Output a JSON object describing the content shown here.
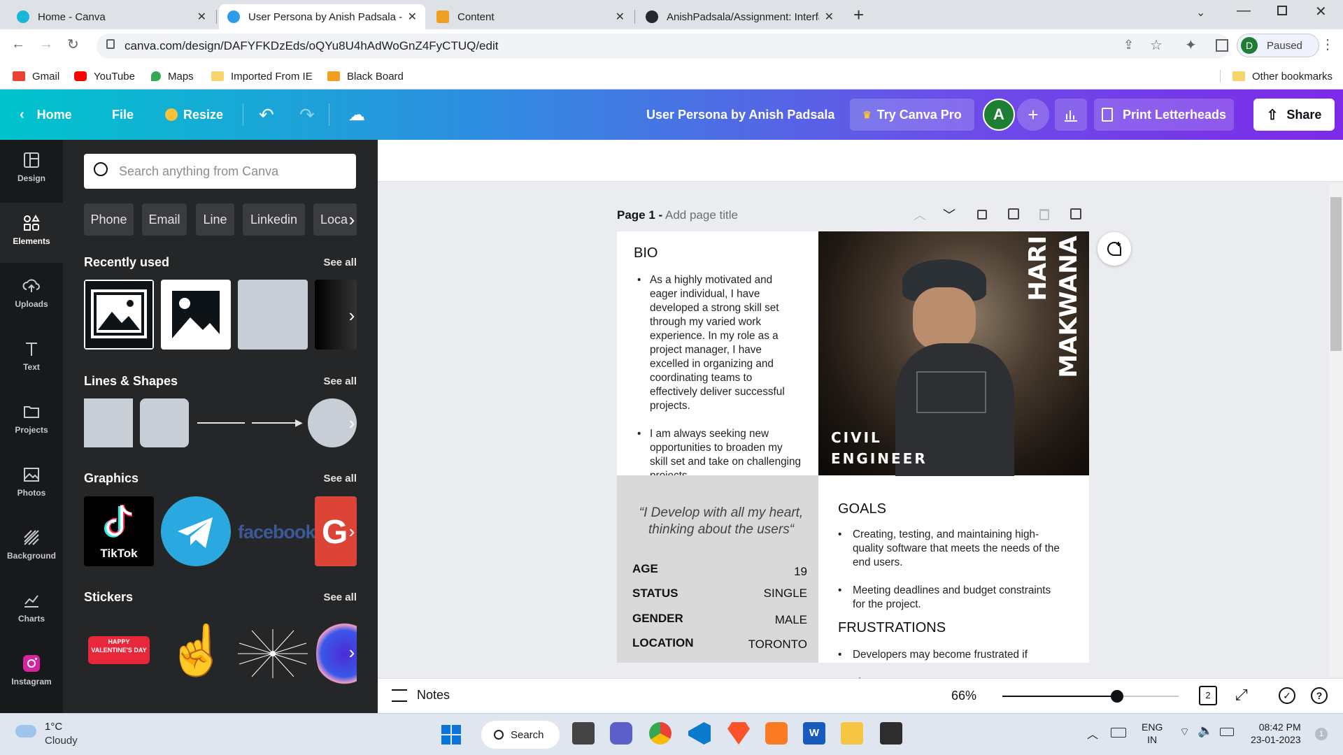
{
  "browser": {
    "tabs": [
      {
        "title": "Home - Canva",
        "active": false
      },
      {
        "title": "User Persona by Anish Padsala - Canva",
        "active": true
      },
      {
        "title": "Content",
        "active": false
      },
      {
        "title": "AnishPadsala/Assignment: Interface",
        "active": false
      }
    ],
    "url": "canva.com/design/DAFYFKDzEds/oQYu8U4hAdWoGnZ4FyCTUQ/edit",
    "profile_initial": "D",
    "profile_status": "Paused",
    "bookmarks": [
      "Gmail",
      "YouTube",
      "Maps",
      "Imported From IE",
      "Black Board"
    ],
    "other_bookmarks": "Other bookmarks"
  },
  "header": {
    "home": "Home",
    "file": "File",
    "resize": "Resize",
    "doc_title": "User Persona by Anish Padsala",
    "try_pro": "Try Canva Pro",
    "avatar_initial": "A",
    "print": "Print Letterheads",
    "share": "Share"
  },
  "rail": [
    {
      "label": "Design",
      "icon": "design-icon"
    },
    {
      "label": "Elements",
      "icon": "elements-icon"
    },
    {
      "label": "Uploads",
      "icon": "upload-icon"
    },
    {
      "label": "Text",
      "icon": "text-icon"
    },
    {
      "label": "Projects",
      "icon": "folder-icon"
    },
    {
      "label": "Photos",
      "icon": "photo-icon"
    },
    {
      "label": "Background",
      "icon": "background-icon"
    },
    {
      "label": "Charts",
      "icon": "chart-icon"
    },
    {
      "label": "Instagram",
      "icon": "instagram-icon"
    }
  ],
  "panel": {
    "search_placeholder": "Search anything from Canva",
    "chips": [
      "Phone",
      "Email",
      "Line",
      "Linkedin",
      "Loca"
    ],
    "recently_used": "Recently used",
    "lines_shapes": "Lines & Shapes",
    "graphics": "Graphics",
    "stickers": "Stickers",
    "see_all": "See all",
    "tiktok_label": "TikTok",
    "facebook_label": "facebook",
    "sticker_text": "HAPPY VALENTINE'S DAY"
  },
  "page": {
    "page_label": "Page 1 -",
    "page_title_placeholder": "Add page title",
    "bio_heading": "BIO",
    "bio_points": [
      "As a highly motivated and eager individual, I have developed a strong skill set through my varied work experience. In my role as a project manager, I have excelled in organizing and coordinating teams to effectively deliver successful projects.",
      "I am always seeking new opportunities to broaden my skill set and take on challenging projects."
    ],
    "first_name": "HARI",
    "last_name": "MAKWANA",
    "role_line1": "CIVIL",
    "role_line2": "ENGINEER",
    "quote": "“I Develop with all my heart, thinking about the users“",
    "details": [
      {
        "label": "AGE",
        "value": "19"
      },
      {
        "label": "STATUS",
        "value": "SINGLE"
      },
      {
        "label": "GENDER",
        "value": "MALE"
      },
      {
        "label": "LOCATION",
        "value": "TORONTO"
      }
    ],
    "goals_heading": "GOALS",
    "goals": [
      "Creating, testing, and maintaining high-quality software that meets the needs of the end users.",
      "Meeting deadlines and budget constraints for the project."
    ],
    "frustrations_heading": "FRUSTRATIONS",
    "frustrations": [
      "Developers may become frustrated if"
    ]
  },
  "footer": {
    "notes": "Notes",
    "zoom": "66%",
    "zoom_fraction": 0.66,
    "page_count": "2"
  },
  "taskbar": {
    "temp": "1°C",
    "weather": "Cloudy",
    "search": "Search",
    "lang1": "ENG",
    "lang2": "IN",
    "time": "08:42 PM",
    "date": "23-01-2023",
    "notif": "1"
  },
  "colors": {
    "canva_teal": "#00c4cc",
    "canva_purple": "#7d2ae8",
    "panel_bg": "#252627",
    "rail_bg": "#18191b"
  }
}
